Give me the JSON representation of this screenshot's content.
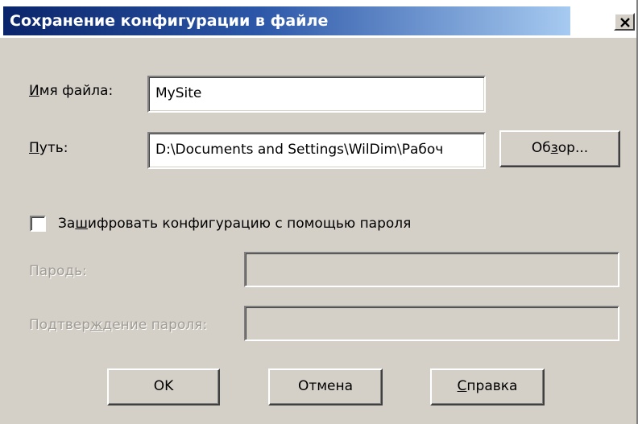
{
  "dialog": {
    "title": "Сохранение конфигурации в файле",
    "close_glyph": "×"
  },
  "form": {
    "filename": {
      "label_pre": "",
      "label_key": "И",
      "label_post": "мя файла:",
      "value": "MySite"
    },
    "path": {
      "label_pre": "",
      "label_key": "П",
      "label_post": "уть:",
      "value": "D:\\Documents and Settings\\WilDim\\Рабоч"
    },
    "browse": {
      "pre": "Об",
      "key": "з",
      "post": "ор..."
    },
    "encrypt": {
      "checked": false,
      "pre": "За",
      "key": "ш",
      "post": "ифровать конфигурацию с помощью пароля"
    },
    "password": {
      "label_pre": "Паро",
      "label_key": "д",
      "label_post": "ь:",
      "value": ""
    },
    "confirm": {
      "label_pre": "Подтвер",
      "label_key": "ж",
      "label_post": "дение пароля:",
      "value": ""
    }
  },
  "buttons": {
    "ok": "OK",
    "cancel": "Отмена",
    "help": {
      "pre": "",
      "key": "С",
      "post": "правка"
    }
  },
  "colors": {
    "face": "#d4d0c8",
    "title_start": "#0a246a",
    "title_end": "#a6caf0"
  },
  "icons": {
    "close": "close-icon",
    "checkbox": "checkbox-unchecked"
  }
}
